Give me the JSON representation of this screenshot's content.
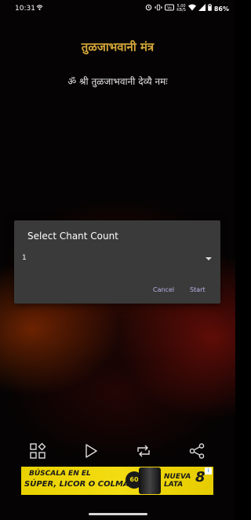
{
  "status_bar": {
    "time": "10:31",
    "left_icon": "wifi-hotspot-icon",
    "net_speed_value": "5.00",
    "net_speed_unit": "KB/S",
    "icons": [
      "alarm-icon",
      "vibrate-icon",
      "volte-icon",
      "wifi-icon",
      "signal-icon",
      "battery-icon"
    ],
    "battery": "86%"
  },
  "header": {
    "title": "तुळजाभवानी मंत्र",
    "title_color": "#d4a63a"
  },
  "mantra": {
    "text": "ॐ श्री तुळजाभवानी देव्यै नमः"
  },
  "dialog": {
    "title": "Select Chant Count",
    "selected_count": "1",
    "cancel_label": "Cancel",
    "start_label": "Start",
    "accent_color": "#bcb2e8"
  },
  "toolbar": {
    "icons": [
      "apps-icon",
      "play-icon",
      "repeat-icon",
      "share-icon"
    ]
  },
  "ad": {
    "line1": "BÚSCALA EN EL",
    "line2": "SÚPER, LICOR O COLMADO.",
    "badge": "60",
    "line3a": "NUEVA",
    "line3b": "LATA",
    "size": "8",
    "info": "i"
  }
}
